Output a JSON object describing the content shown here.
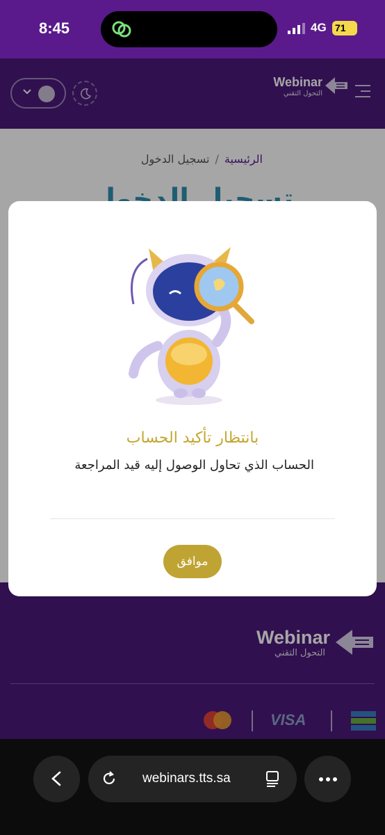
{
  "status_bar": {
    "time": "8:45",
    "network": "4G",
    "battery": "71"
  },
  "header": {
    "logo_word": "Webinar",
    "logo_tagline": "التحول التقني"
  },
  "breadcrumb": {
    "home": "الرئيسية",
    "separator": "/",
    "current": "تسجيل الدخول"
  },
  "page": {
    "title": "تسجيل الدخول"
  },
  "modal": {
    "title": "بانتظار تأكيد الحساب",
    "message": "الحساب الذي تحاول الوصول إليه قيد المراجعة",
    "ok_label": "موافق"
  },
  "footer": {
    "logo_word": "Webinar",
    "logo_tagline": "التحول التقني",
    "payments": [
      "mastercard",
      "VISA",
      "sadad"
    ]
  },
  "browser": {
    "url": "webinars.tts.sa"
  },
  "colors": {
    "brand_purple": "#4b1a7a",
    "accent_gold": "#bfa434",
    "title_blue": "#2f8fb0"
  }
}
